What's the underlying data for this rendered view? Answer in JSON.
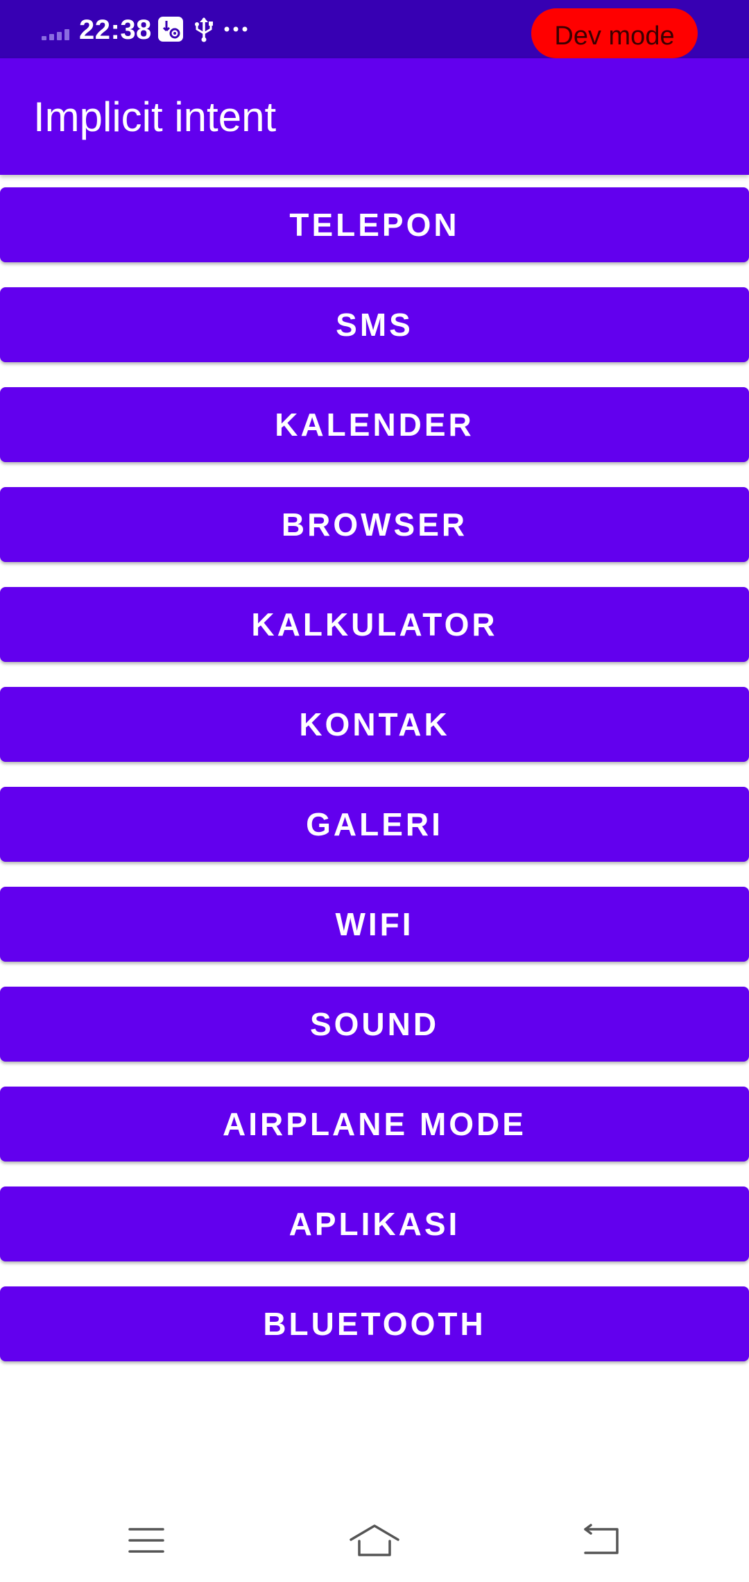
{
  "status_bar": {
    "time": "22:38",
    "icons": [
      "signal-icon",
      "usb-debug-icon",
      "usb-icon",
      "more-dots-icon"
    ],
    "dev_badge": "Dev mode"
  },
  "app_bar": {
    "title": "Implicit intent"
  },
  "buttons": [
    "TELEPON",
    "SMS",
    "KALENDER",
    "BROWSER",
    "KALKULATOR",
    "KONTAK",
    "GALERI",
    "WIFI",
    "SOUND",
    "AIRPLANE MODE",
    "APLIKASI",
    "BLUETOOTH"
  ],
  "nav_bar": {
    "icons": [
      "menu-icon",
      "home-icon",
      "back-icon"
    ]
  },
  "colors": {
    "status_bar": "#3700b3",
    "primary": "#6200ee",
    "button_text": "#ffffff",
    "dev_badge": "#ff0000"
  }
}
